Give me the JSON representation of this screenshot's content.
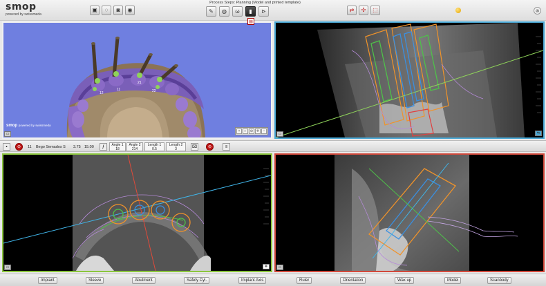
{
  "app": {
    "logo": "smop",
    "logo_sub": "powered by swissmeda"
  },
  "header": {
    "process_steps": "Process Steps: Planning (Model and printed template)",
    "left_icons": [
      "save-icon",
      "lightbulb-icon",
      "camera-icon",
      "record-icon"
    ],
    "step_icons": [
      "model-step-icon",
      "scan-step-icon",
      "teeth-step-icon",
      "implant-step-icon",
      "template-step-icon"
    ],
    "view_icons": [
      "layout-icon-1",
      "layout-icon-2",
      "layout-icon-3"
    ]
  },
  "info_strip": {
    "implant_id": "11",
    "implant_name": "Bego Semados S",
    "diameter": "3.75",
    "length": "15.00",
    "angle1_label": "Angle 1",
    "angle1_value": "18",
    "angle2_label": "Angle 2",
    "angle2_value": "214",
    "length1_label": "Length 1",
    "length1_value": "0.5",
    "length2_label": "Length 2",
    "length2_value": "3"
  },
  "viewports": {
    "model_3d": {
      "tooth_labels": [
        "12",
        "11",
        "21",
        "22"
      ],
      "logo": "smop",
      "logo_sub": "powered by swissmeda"
    }
  },
  "bottom_buttons": {
    "implant": "Implant",
    "sleeve": "Sleeve",
    "abutment": "Abutment",
    "safety_cyl": "Safety Cyl.",
    "implant_axis": "Implant Axis",
    "ruler": "Ruler",
    "orientation": "Orientation",
    "wax_up": "Wax up",
    "model": "Model",
    "scanbody": "Scanbody"
  },
  "colors": {
    "model_bg": "#6f7fe0",
    "axial_border": "#4aa7d4",
    "panoramic_border": "#8cc63f",
    "cross_border": "#d24a3c"
  }
}
